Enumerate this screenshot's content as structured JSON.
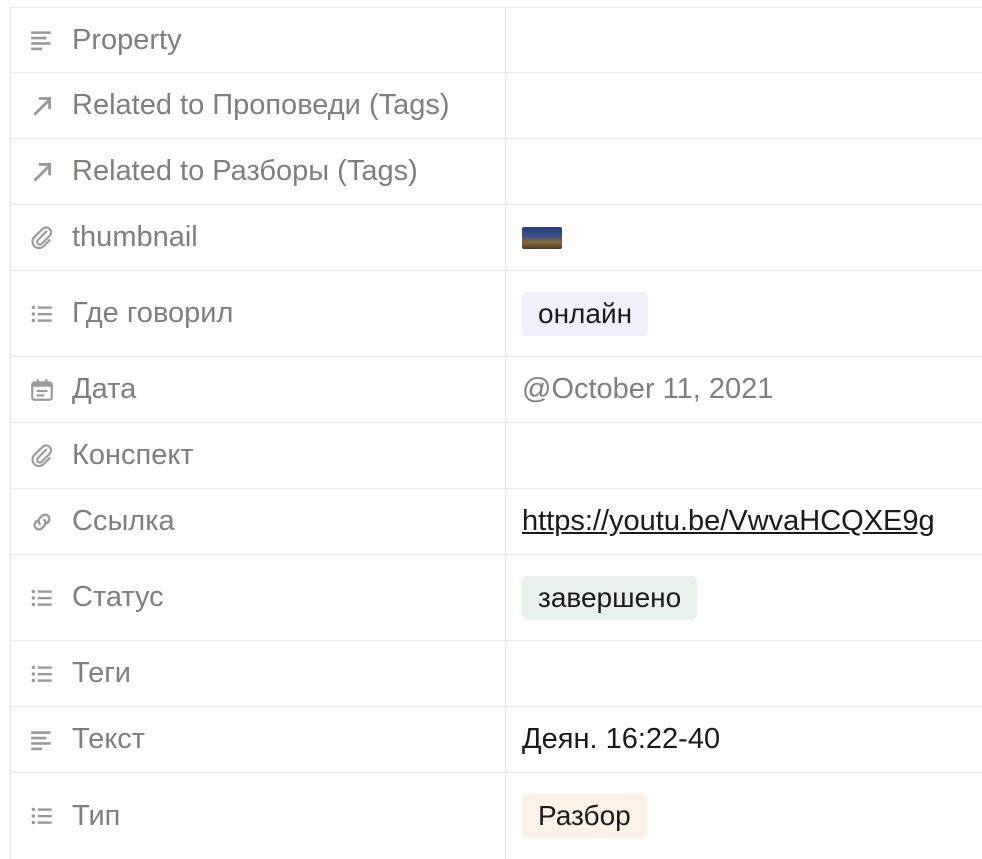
{
  "rows": [
    {
      "name": "Property",
      "icon": "text-lines-icon",
      "value": ""
    },
    {
      "name": "Related to Проповеди (Tags)",
      "icon": "arrow-up-right-icon",
      "value": ""
    },
    {
      "name": "Related to Разборы (Tags)",
      "icon": "arrow-up-right-icon",
      "value": ""
    },
    {
      "name": "thumbnail",
      "icon": "paperclip-icon",
      "value": "thumbnail-image"
    },
    {
      "name": "Где говорил",
      "icon": "list-icon",
      "value": "онлайн"
    },
    {
      "name": "Дата",
      "icon": "calendar-icon",
      "value": "@October 11, 2021"
    },
    {
      "name": "Конспект",
      "icon": "paperclip-icon",
      "value": ""
    },
    {
      "name": "Ссылка",
      "icon": "link-icon",
      "value": "https://youtu.be/VwvaHCQXE9g"
    },
    {
      "name": "Статус",
      "icon": "list-icon",
      "value": "завершено"
    },
    {
      "name": "Теги",
      "icon": "list-icon",
      "value": ""
    },
    {
      "name": "Текст",
      "icon": "text-lines-icon",
      "value": "Деян. 16:22-40"
    },
    {
      "name": "Тип",
      "icon": "list-icon",
      "value": "Разбор"
    }
  ],
  "colors": {
    "label": "#807f7b",
    "border": "#e9e9e7",
    "tag_purple": "#f3eefb",
    "tag_green": "#e8f2ea",
    "tag_orange": "#fdf2e6"
  }
}
